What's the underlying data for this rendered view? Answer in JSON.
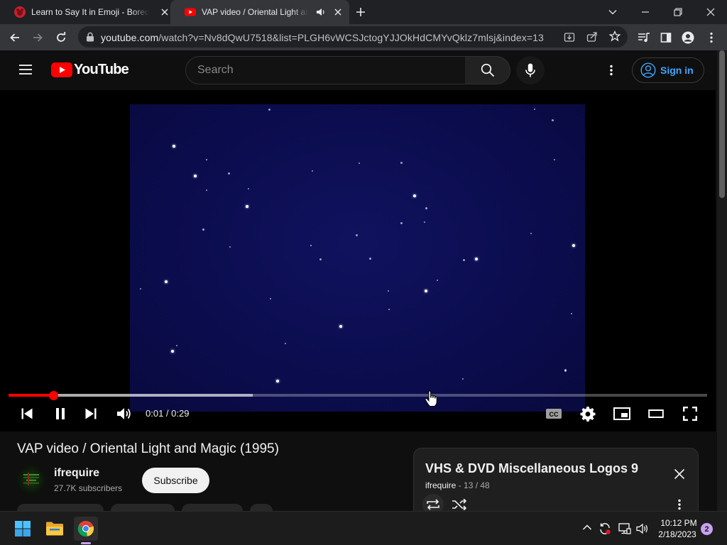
{
  "browser": {
    "tabs": [
      {
        "title": "Learn to Say It in Emoji - Bored B",
        "favicon": "bored-panda-icon",
        "active": false
      },
      {
        "title": "VAP video / Oriental Light and Magic",
        "favicon": "youtube-icon",
        "active": true,
        "audio": true
      }
    ],
    "url_host": "youtube.com",
    "url_rest": "/watch?v=Nv8dQwU7518&list=PLGH6vWCSJctogYJJOkHdCMYvQklz7mlsj&index=13"
  },
  "youtube": {
    "logo_text": "YouTube",
    "search_placeholder": "Search",
    "signin_label": "Sign in"
  },
  "player": {
    "time_current": "0:01",
    "time_separator": " / ",
    "time_total": "0:29",
    "played_fraction": 0.065,
    "buffered_fraction": 0.35,
    "cursor": "hand-pointer"
  },
  "video": {
    "title": "VAP video / Oriental Light and Magic (1995)",
    "channel": "ifrequire",
    "subscribers": "27.7K subscribers",
    "subscribe_label": "Subscribe"
  },
  "playlist": {
    "title": "VHS & DVD Miscellaneous Logos 9",
    "owner": "ifrequire",
    "position": " - 13 / 48"
  },
  "taskbar": {
    "time": "10:12 PM",
    "date": "2/18/2023",
    "notifications": "2"
  },
  "colors": {
    "accent_red": "#ff0000",
    "link_blue": "#3ea6ff",
    "video_bg": "#0b0c4d"
  }
}
